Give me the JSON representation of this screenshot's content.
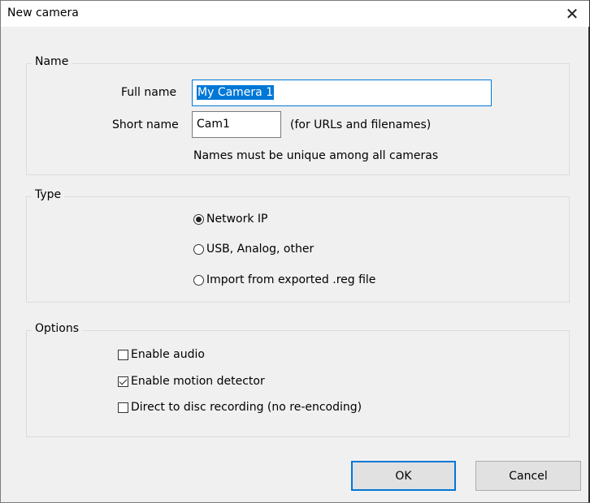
{
  "window": {
    "title": "New camera",
    "close_glyph": "✕"
  },
  "name_group": {
    "label": "Name",
    "full_name_label": "Full name",
    "full_name_value": "My Camera 1",
    "short_name_label": "Short name",
    "short_name_value": "Cam1",
    "short_name_hint": "(for URLs and filenames)",
    "uniqueness_note": "Names must be unique among all cameras"
  },
  "type_group": {
    "label": "Type",
    "options": [
      {
        "label": "Network IP",
        "selected": true
      },
      {
        "label": "USB, Analog, other",
        "selected": false
      },
      {
        "label": "Import from exported .reg file",
        "selected": false
      }
    ]
  },
  "options_group": {
    "label": "Options",
    "checkboxes": [
      {
        "label": "Enable audio",
        "checked": false
      },
      {
        "label": "Enable motion detector",
        "checked": true
      },
      {
        "label": "Direct to disc recording (no re-encoding)",
        "checked": false
      }
    ]
  },
  "buttons": {
    "ok": "OK",
    "cancel": "Cancel"
  },
  "colors": {
    "accent": "#0078d7",
    "background": "#f0f0f0",
    "titlebar": "#ffffff"
  }
}
